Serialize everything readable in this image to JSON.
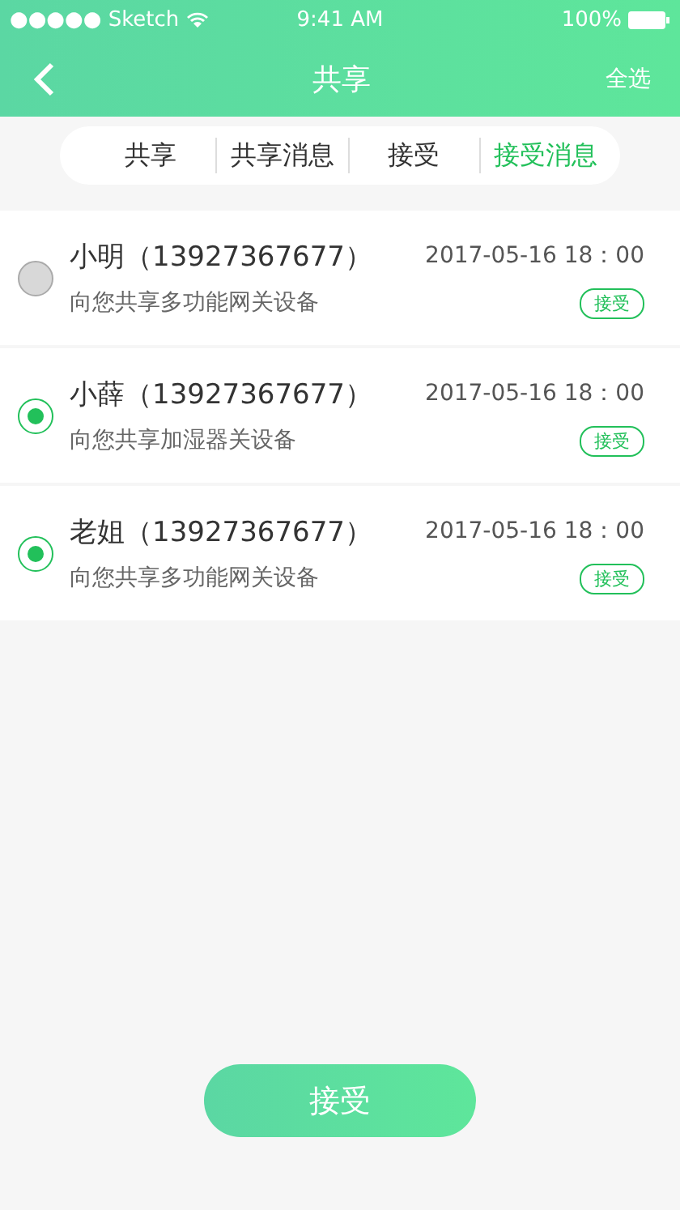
{
  "status_bar": {
    "carrier": "●●●●● Sketch",
    "time": "9:41 AM",
    "battery": "100%"
  },
  "nav": {
    "title": "共享",
    "action": "全选"
  },
  "tabs": [
    {
      "label": "共享",
      "selected": false
    },
    {
      "label": "共享消息",
      "selected": false
    },
    {
      "label": "接受",
      "selected": false
    },
    {
      "label": "接受消息",
      "selected": true
    }
  ],
  "items": [
    {
      "name": "小明（13927367677）",
      "time": "2017-05-16 18：00",
      "message": "向您共享多功能网关设备",
      "tag": "接受",
      "selected": false
    },
    {
      "name": "小薛（13927367677）",
      "time": "2017-05-16 18：00",
      "message": "向您共享加湿器关设备",
      "tag": "接受",
      "selected": true
    },
    {
      "name": "老姐（13927367677）",
      "time": "2017-05-16 18：00",
      "message": "向您共享多功能网关设备",
      "tag": "接受",
      "selected": true
    }
  ],
  "button": "接受"
}
